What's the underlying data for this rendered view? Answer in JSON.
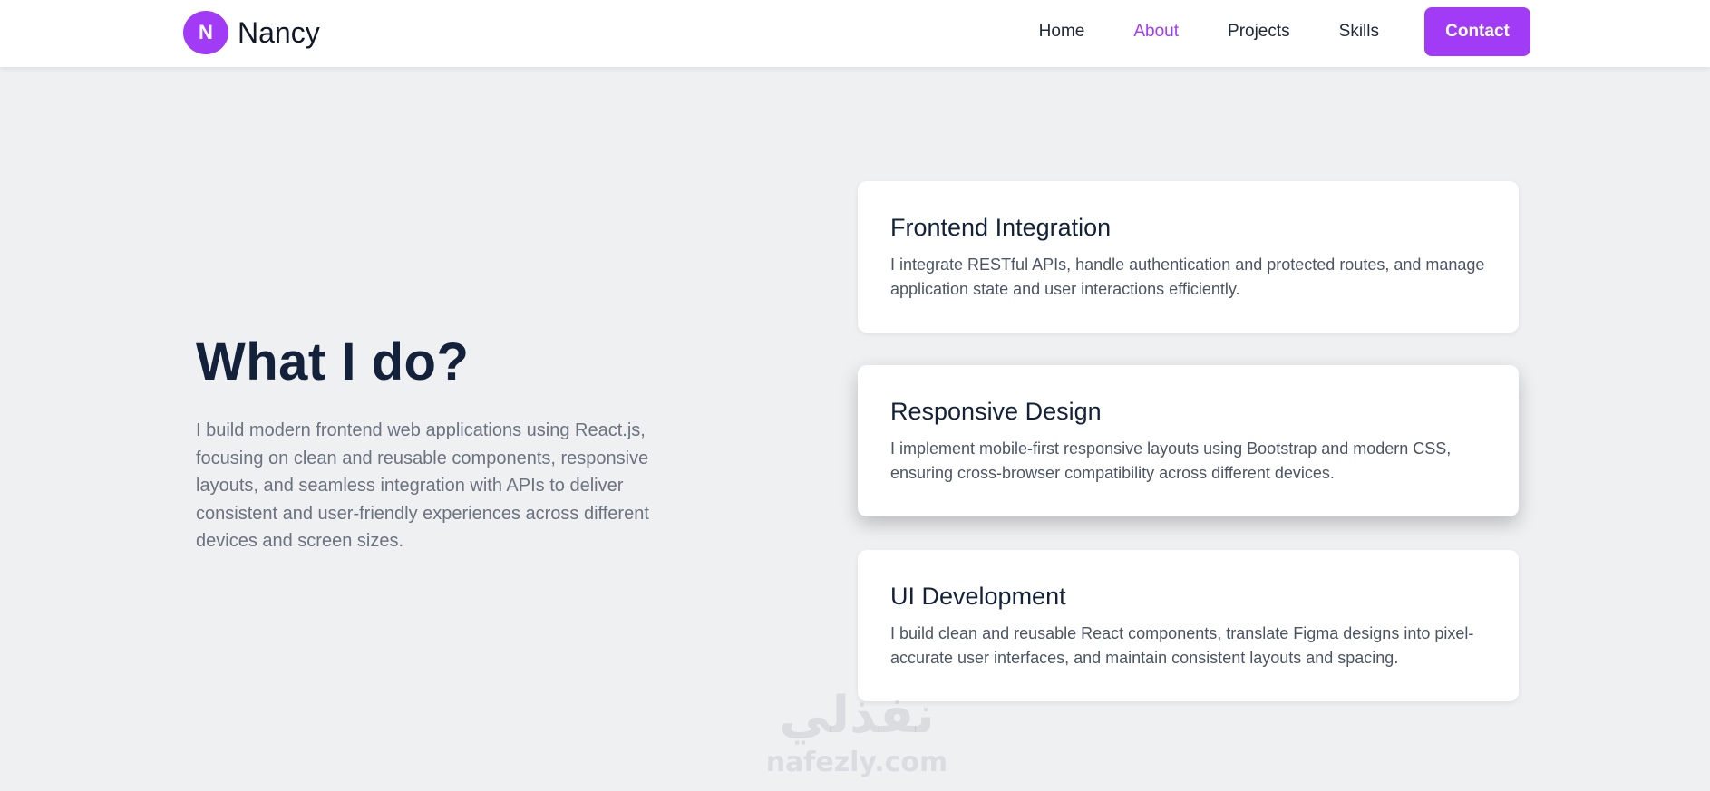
{
  "brand": {
    "initial": "N",
    "name": "Nancy"
  },
  "nav": {
    "links": [
      {
        "label": "Home"
      },
      {
        "label": "About"
      },
      {
        "label": "Projects"
      },
      {
        "label": "Skills"
      }
    ],
    "active": "About",
    "contact_label": "Contact"
  },
  "hero": {
    "title": "What I do?",
    "description": "I build modern frontend web applications using React.js, focusing on clean and reusable components, responsive layouts, and seamless integration with APIs to deliver consistent and user-friendly experiences across different devices and screen sizes."
  },
  "cards": [
    {
      "title": "Frontend Integration",
      "text": "I integrate RESTful APIs, handle authentication and protected routes, and manage application state and user interactions efficiently."
    },
    {
      "title": "Responsive Design",
      "text": "I implement mobile-first responsive layouts using Bootstrap and modern CSS, ensuring cross-browser compatibility across different devices."
    },
    {
      "title": "UI Development",
      "text": "I build clean and reusable React components, translate Figma designs into pixel-accurate user interfaces, and maintain consistent layouts and spacing."
    }
  ],
  "watermark": {
    "logo": "نفذلي",
    "url": "nafezly.com"
  },
  "colors": {
    "accent": "#a23bf5",
    "background": "#eff0f2",
    "heading": "#14213a",
    "muted_text": "#6b7280"
  }
}
